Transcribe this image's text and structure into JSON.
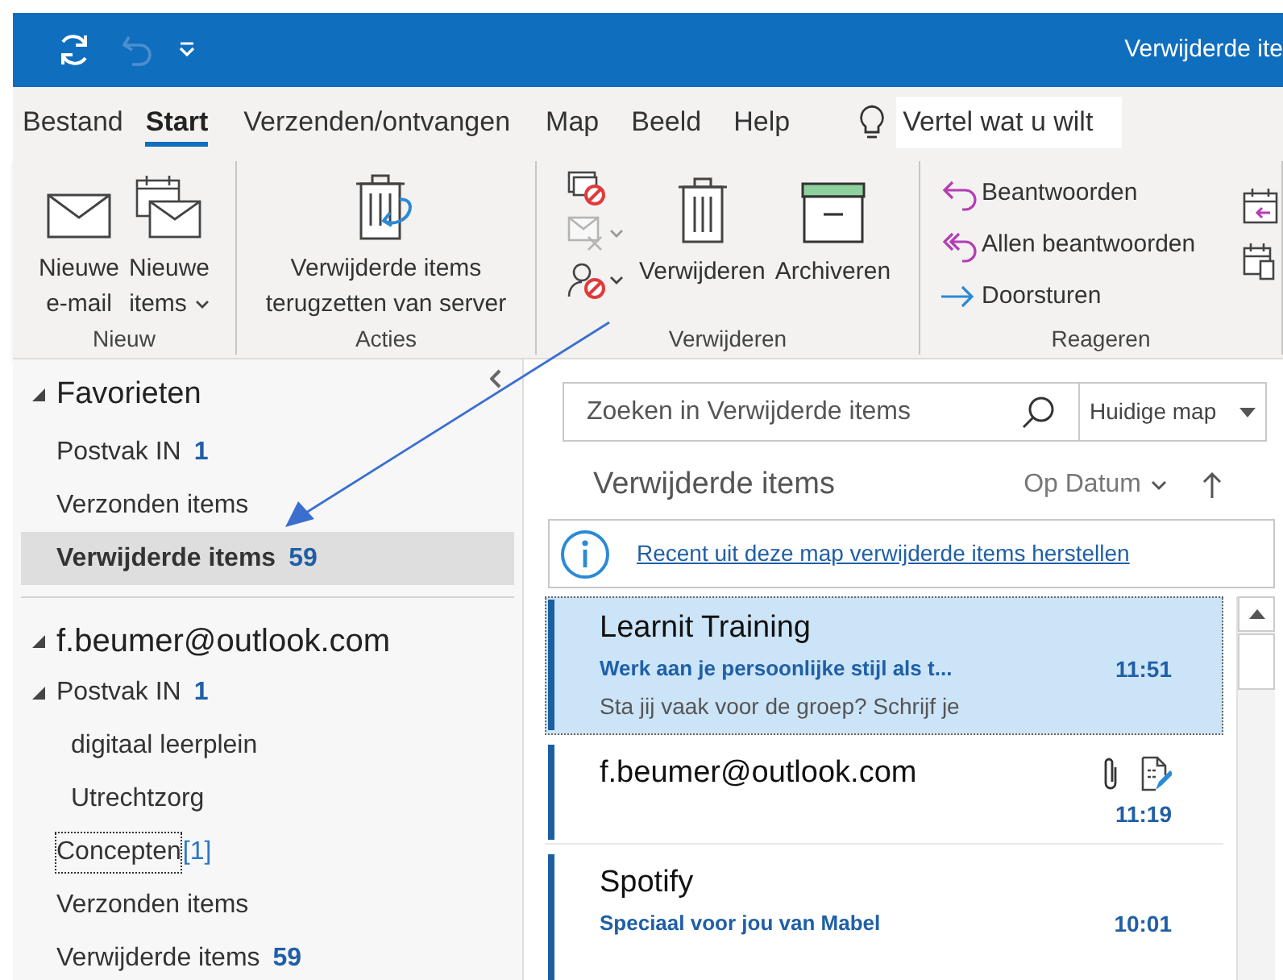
{
  "window": {
    "title": "Verwijderde ite"
  },
  "quick_access": {
    "undo_disabled": true
  },
  "tabs": [
    {
      "label": "Bestand",
      "selected": false
    },
    {
      "label": "Start",
      "selected": true
    },
    {
      "label": "Verzenden/ontvangen",
      "selected": false
    },
    {
      "label": "Map",
      "selected": false
    },
    {
      "label": "Beeld",
      "selected": false
    },
    {
      "label": "Help",
      "selected": false
    }
  ],
  "tell_me": {
    "placeholder": "Vertel wat u wilt"
  },
  "ribbon": {
    "groups": [
      {
        "label": "Nieuw",
        "buttons": [
          {
            "kind": "mail",
            "lines": [
              "Nieuwe",
              "e-mail"
            ],
            "dropdown": false
          },
          {
            "kind": "items",
            "lines": [
              "Nieuwe",
              "items"
            ],
            "dropdown": true
          }
        ]
      },
      {
        "label": "Acties",
        "buttons": [
          {
            "kind": "restore",
            "lines": [
              "Verwijderde items",
              "terugzetten van server"
            ],
            "dropdown": false
          }
        ]
      },
      {
        "label": "Verwijderen",
        "buttons": [
          {
            "kind": "small-stack"
          },
          {
            "kind": "delete",
            "lines": [
              "Verwijderen"
            ],
            "dropdown": false
          },
          {
            "kind": "archive",
            "lines": [
              "Archiveren"
            ],
            "dropdown": false
          }
        ]
      },
      {
        "label": "Reageren",
        "buttons": [
          {
            "kind": "reply-list",
            "lines": [
              "Beantwoorden",
              "Allen beantwoorden",
              "Doorsturen"
            ]
          }
        ]
      }
    ]
  },
  "folder_pane": {
    "favorites": {
      "label": "Favorieten",
      "expanded": true,
      "items": [
        {
          "label": "Postvak IN",
          "count": "1",
          "selected": false
        },
        {
          "label": "Verzonden items",
          "selected": false
        },
        {
          "label": "Verwijderde items",
          "count": "59",
          "selected": true
        }
      ]
    },
    "account": {
      "label": "f.beumer@outlook.com",
      "expanded": true,
      "children": [
        {
          "label": "Postvak IN",
          "count": "1",
          "expanded": true,
          "children": [
            {
              "label": "digitaal leerplein"
            },
            {
              "label": "Utrechtzorg"
            }
          ]
        },
        {
          "label": "Concepten",
          "count": "[1]",
          "focused": true
        },
        {
          "label": "Verzonden items"
        },
        {
          "label": "Verwijderde items",
          "count": "59"
        }
      ]
    }
  },
  "search": {
    "placeholder": "Zoeken in Verwijderde items",
    "scope": "Huidige map"
  },
  "message_list": {
    "title": "Verwijderde items",
    "sort": "Op Datum",
    "info_link": "Recent uit deze map verwijderde items herstellen",
    "messages": [
      {
        "sender": "Learnit Training",
        "subject": "Werk aan je persoonlijke stijl als t...",
        "preview": "Sta jij vaak voor de groep? Schrijf je",
        "time": "11:51",
        "selected": true,
        "attachment": false,
        "draft": false
      },
      {
        "sender": "f.beumer@outlook.com",
        "time": "11:19",
        "selected": false,
        "attachment": true,
        "draft": true
      },
      {
        "sender": "Spotify",
        "subject": "Speciaal voor jou van Mabel",
        "time": "10:01",
        "selected": false,
        "attachment": false,
        "draft": false
      }
    ]
  }
}
